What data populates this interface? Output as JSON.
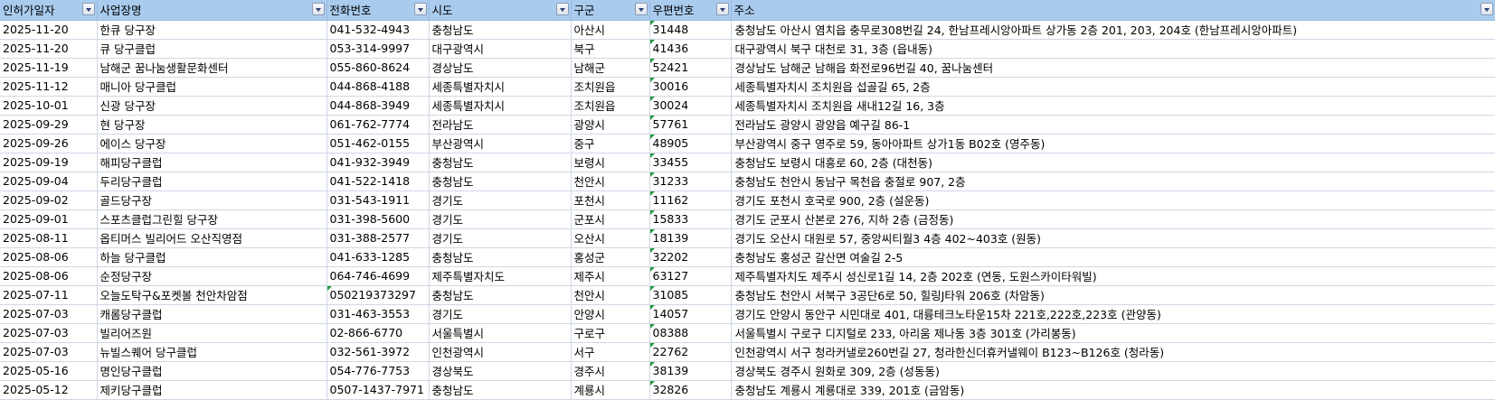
{
  "headers": [
    "인허가일자",
    "사업장명",
    "전화번호",
    "시도",
    "구군",
    "우편번호",
    "주소"
  ],
  "rows": [
    {
      "date": "2025-11-20",
      "name": "한큐 당구장",
      "phone": "041-532-4943",
      "sido": "충청남도",
      "gugun": "아산시",
      "zip": "31448",
      "addr": "충청남도 아산시 염치읍 충무로308번길 24, 한남프레시앙아파트 상가동 2층 201, 203, 204호 (한남프레시앙아파트)"
    },
    {
      "date": "2025-11-20",
      "name": "큐 당구클럽",
      "phone": "053-314-9997",
      "sido": "대구광역시",
      "gugun": "북구",
      "zip": "41436",
      "addr": "대구광역시 북구 대천로 31, 3층 (읍내동)"
    },
    {
      "date": "2025-11-19",
      "name": "남해군 꿈나눔생활문화센터",
      "phone": "055-860-8624",
      "sido": "경상남도",
      "gugun": "남해군",
      "zip": "52421",
      "addr": "경상남도 남해군 남해읍 화전로96번길 40, 꿈나눔센터"
    },
    {
      "date": "2025-11-12",
      "name": "매니아 당구클럽",
      "phone": "044-868-4188",
      "sido": "세종특별자치시",
      "gugun": "조치원읍",
      "zip": "30016",
      "addr": "세종특별자치시 조치원읍 섭골길 65, 2층"
    },
    {
      "date": "2025-10-01",
      "name": "신광 당구장",
      "phone": "044-868-3949",
      "sido": "세종특별자치시",
      "gugun": "조치원읍",
      "zip": "30024",
      "addr": "세종특별자치시 조치원읍 새내12길 16, 3층"
    },
    {
      "date": "2025-09-29",
      "name": "현 당구장",
      "phone": "061-762-7774",
      "sido": "전라남도",
      "gugun": "광양시",
      "zip": "57761",
      "addr": "전라남도 광양시 광양읍 예구길 86-1"
    },
    {
      "date": "2025-09-26",
      "name": "에이스 당구장",
      "phone": "051-462-0155",
      "sido": "부산광역시",
      "gugun": "중구",
      "zip": "48905",
      "addr": "부산광역시 중구 영주로 59, 동아아파트 상가1동 B02호 (영주동)"
    },
    {
      "date": "2025-09-19",
      "name": "해피당구클럽",
      "phone": "041-932-3949",
      "sido": "충청남도",
      "gugun": "보령시",
      "zip": "33455",
      "addr": "충청남도 보령시 대흥로 60, 2층 (대천동)"
    },
    {
      "date": "2025-09-04",
      "name": "두리당구클럽",
      "phone": "041-522-1418",
      "sido": "충청남도",
      "gugun": "천안시",
      "zip": "31233",
      "addr": "충청남도 천안시 동남구 목천읍 충절로 907, 2층"
    },
    {
      "date": "2025-09-02",
      "name": "골드당구장",
      "phone": "031-543-1911",
      "sido": "경기도",
      "gugun": "포천시",
      "zip": "11162",
      "addr": "경기도 포천시 호국로 900, 2층 (설운동)"
    },
    {
      "date": "2025-09-01",
      "name": "스포츠클럽그린힐 당구장",
      "phone": "031-398-5600",
      "sido": "경기도",
      "gugun": "군포시",
      "zip": "15833",
      "addr": "경기도 군포시 산본로 276, 지하 2층 (금정동)"
    },
    {
      "date": "2025-08-11",
      "name": "옵티머스 빌리어드 오산직영점",
      "phone": "031-388-2577",
      "sido": "경기도",
      "gugun": "오산시",
      "zip": "18139",
      "addr": "경기도 오산시 대원로 57, 중앙씨티월3 4층 402~403호 (원동)"
    },
    {
      "date": "2025-08-06",
      "name": "하늘 당구클럽",
      "phone": "041-633-1285",
      "sido": "충청남도",
      "gugun": "홍성군",
      "zip": "32202",
      "addr": "충청남도 홍성군 갈산면 여술길 2-5"
    },
    {
      "date": "2025-08-06",
      "name": "순정당구장",
      "phone": "064-746-4699",
      "sido": "제주특별자치도",
      "gugun": "제주시",
      "zip": "63127",
      "addr": "제주특별자치도 제주시 성신로1길 14, 2층 202호 (연동, 도원스카이타워빌)"
    },
    {
      "date": "2025-07-11",
      "name": "오늘도탁구&포켓볼 천안차암점",
      "phone": "050219373297",
      "sido": "충청남도",
      "gugun": "천안시",
      "zip": "31085",
      "addr": "충청남도 천안시 서북구 3공단6로 50, 힐링J타워 206호 (차암동)",
      "phone_flag": true
    },
    {
      "date": "2025-07-03",
      "name": "캐롬당구클럽",
      "phone": "031-463-3553",
      "sido": "경기도",
      "gugun": "안양시",
      "zip": "14057",
      "addr": "경기도 안양시 동안구 시민대로 401, 대륭테크노타운15차 221호,222호,223호 (관양동)"
    },
    {
      "date": "2025-07-03",
      "name": "빌리어즈원",
      "phone": "02-866-6770",
      "sido": "서울특별시",
      "gugun": "구로구",
      "zip": "08388",
      "addr": "서울특별시 구로구 디지털로 233, 아리움 제나동 3층 301호 (가리봉동)"
    },
    {
      "date": "2025-07-03",
      "name": "뉴빌스퀘어 당구클럽",
      "phone": "032-561-3972",
      "sido": "인천광역시",
      "gugun": "서구",
      "zip": "22762",
      "addr": "인천광역시 서구 청라커낼로260번길 27, 청라한신더휴커낼웨이 B123~B126호 (청라동)"
    },
    {
      "date": "2025-05-16",
      "name": "명인당구클럽",
      "phone": "054-776-7753",
      "sido": "경상북도",
      "gugun": "경주시",
      "zip": "38139",
      "addr": "경상북도 경주시 원화로 309, 2층 (성동동)"
    },
    {
      "date": "2025-05-12",
      "name": "제키당구클럽",
      "phone": "0507-1437-7971",
      "sido": "충청남도",
      "gugun": "계룡시",
      "zip": "32826",
      "addr": "충청남도 계룡시 계룡대로 339, 201호 (금암동)"
    }
  ]
}
